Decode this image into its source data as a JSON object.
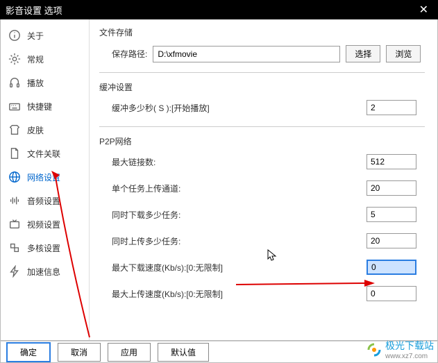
{
  "title": "影音设置 选项",
  "sidebar": {
    "items": [
      {
        "label": "关于"
      },
      {
        "label": "常规"
      },
      {
        "label": "播放"
      },
      {
        "label": "快捷键"
      },
      {
        "label": "皮肤"
      },
      {
        "label": "文件关联"
      },
      {
        "label": "网络设置"
      },
      {
        "label": "音频设置"
      },
      {
        "label": "视频设置"
      },
      {
        "label": "多核设置"
      },
      {
        "label": "加速信息"
      }
    ]
  },
  "storage": {
    "title": "文件存储",
    "path_label": "保存路径:",
    "path_value": "D:\\xfmovie",
    "select_btn": "选择",
    "browse_btn": "浏览"
  },
  "buffer": {
    "title": "缓冲设置",
    "label": "缓冲多少秒( S ):[开始播放]",
    "value": "2"
  },
  "p2p": {
    "title": "P2P网络",
    "rows": [
      {
        "label": "最大链接数:",
        "value": "512"
      },
      {
        "label": "单个任务上传通道:",
        "value": "20"
      },
      {
        "label": "同时下载多少任务:",
        "value": "5"
      },
      {
        "label": "同时上传多少任务:",
        "value": "20"
      },
      {
        "label": "最大下载速度(Kb/s):[0:无限制]",
        "value": "0"
      },
      {
        "label": "最大上传速度(Kb/s):[0:无限制]",
        "value": "0"
      }
    ]
  },
  "footer": {
    "ok": "确定",
    "cancel": "取消",
    "apply": "应用",
    "default": "默认值"
  },
  "watermark": {
    "name": "极光下载站",
    "url": "www.xz7.com"
  }
}
